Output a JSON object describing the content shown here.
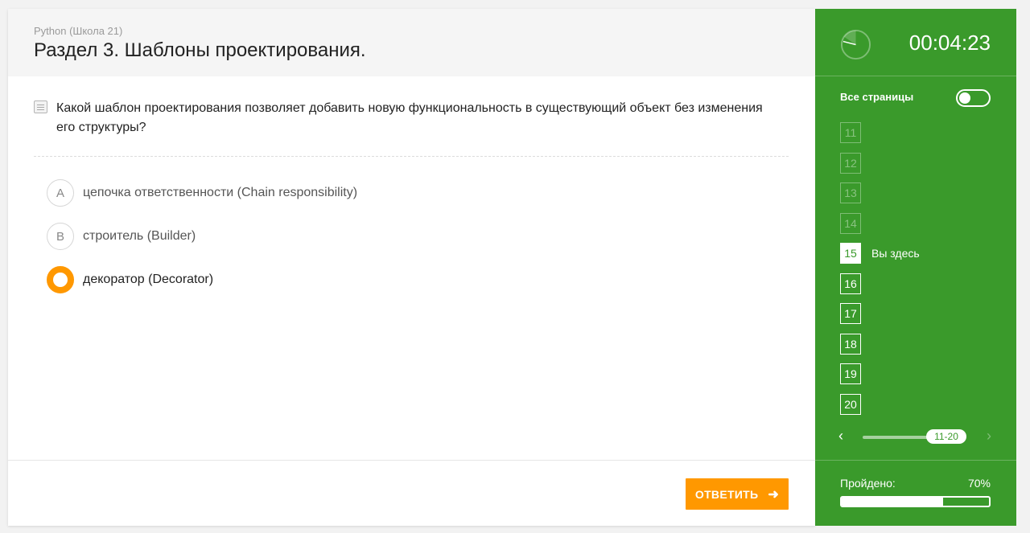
{
  "header": {
    "course": "Python (Школа 21)",
    "section_title": "Раздел 3. Шаблоны проектирования."
  },
  "question": {
    "text": "Какой шаблон проектирования позволяет добавить новую функциональность в существующий объект без изменения его структуры?"
  },
  "options": [
    {
      "letter": "A",
      "label": "цепочка ответственности (Chain responsibility)",
      "selected": false
    },
    {
      "letter": "B",
      "label": "строитель (Builder)",
      "selected": false
    },
    {
      "letter": "",
      "label": "декоратор (Decorator)",
      "selected": true
    }
  ],
  "footer": {
    "answer_label": "ОТВЕТИТЬ"
  },
  "sidebar": {
    "timer": "00:04:23",
    "all_pages_label": "Все страницы",
    "all_pages_toggle_on": false,
    "pages": [
      {
        "num": "11",
        "state": "done"
      },
      {
        "num": "12",
        "state": "done"
      },
      {
        "num": "13",
        "state": "done"
      },
      {
        "num": "14",
        "state": "done"
      },
      {
        "num": "15",
        "state": "current"
      },
      {
        "num": "16",
        "state": "todo"
      },
      {
        "num": "17",
        "state": "todo"
      },
      {
        "num": "18",
        "state": "todo"
      },
      {
        "num": "19",
        "state": "todo"
      },
      {
        "num": "20",
        "state": "todo"
      }
    ],
    "here_label": "Вы здесь",
    "pager_range": "11-20",
    "progress_label": "Пройдено:",
    "progress_value": "70%",
    "progress_fraction": 0.7
  },
  "colors": {
    "accent_green": "#3a9a2b",
    "accent_orange": "#ff9800"
  },
  "icons": {
    "question": "document-icon",
    "clock": "clock-icon",
    "answer_arrow": "arrow-right-icon",
    "prev": "chevron-left-icon",
    "next": "chevron-right-icon"
  }
}
